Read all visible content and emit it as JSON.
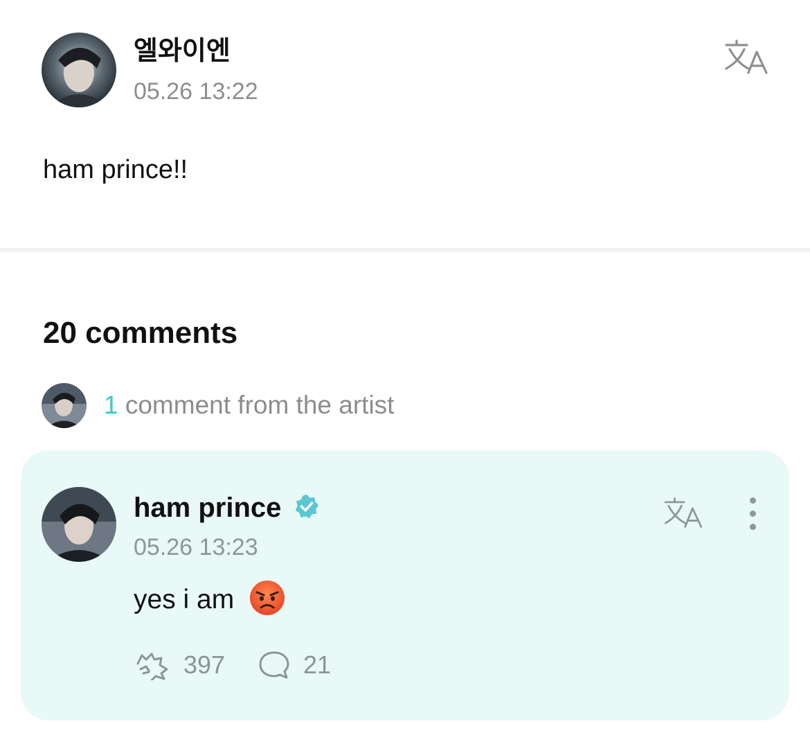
{
  "post": {
    "author": "엘와이엔",
    "timestamp": "05.26 13:22",
    "body": "ham prince!!",
    "avatar_icon": "user-avatar-photo",
    "translate_icon": "translate-icon"
  },
  "comments": {
    "title": "20 comments",
    "artist_summary": {
      "count": "1",
      "label": " comment from the artist",
      "accent_color": "#3cc8c8"
    }
  },
  "artist_comment": {
    "author": "ham prince",
    "verified_icon": "verified-badge-icon",
    "timestamp": "05.26 13:23",
    "body": "yes i am",
    "emoji": "😡",
    "likes": "397",
    "replies": "21",
    "background_color": "#e9f9f7"
  }
}
